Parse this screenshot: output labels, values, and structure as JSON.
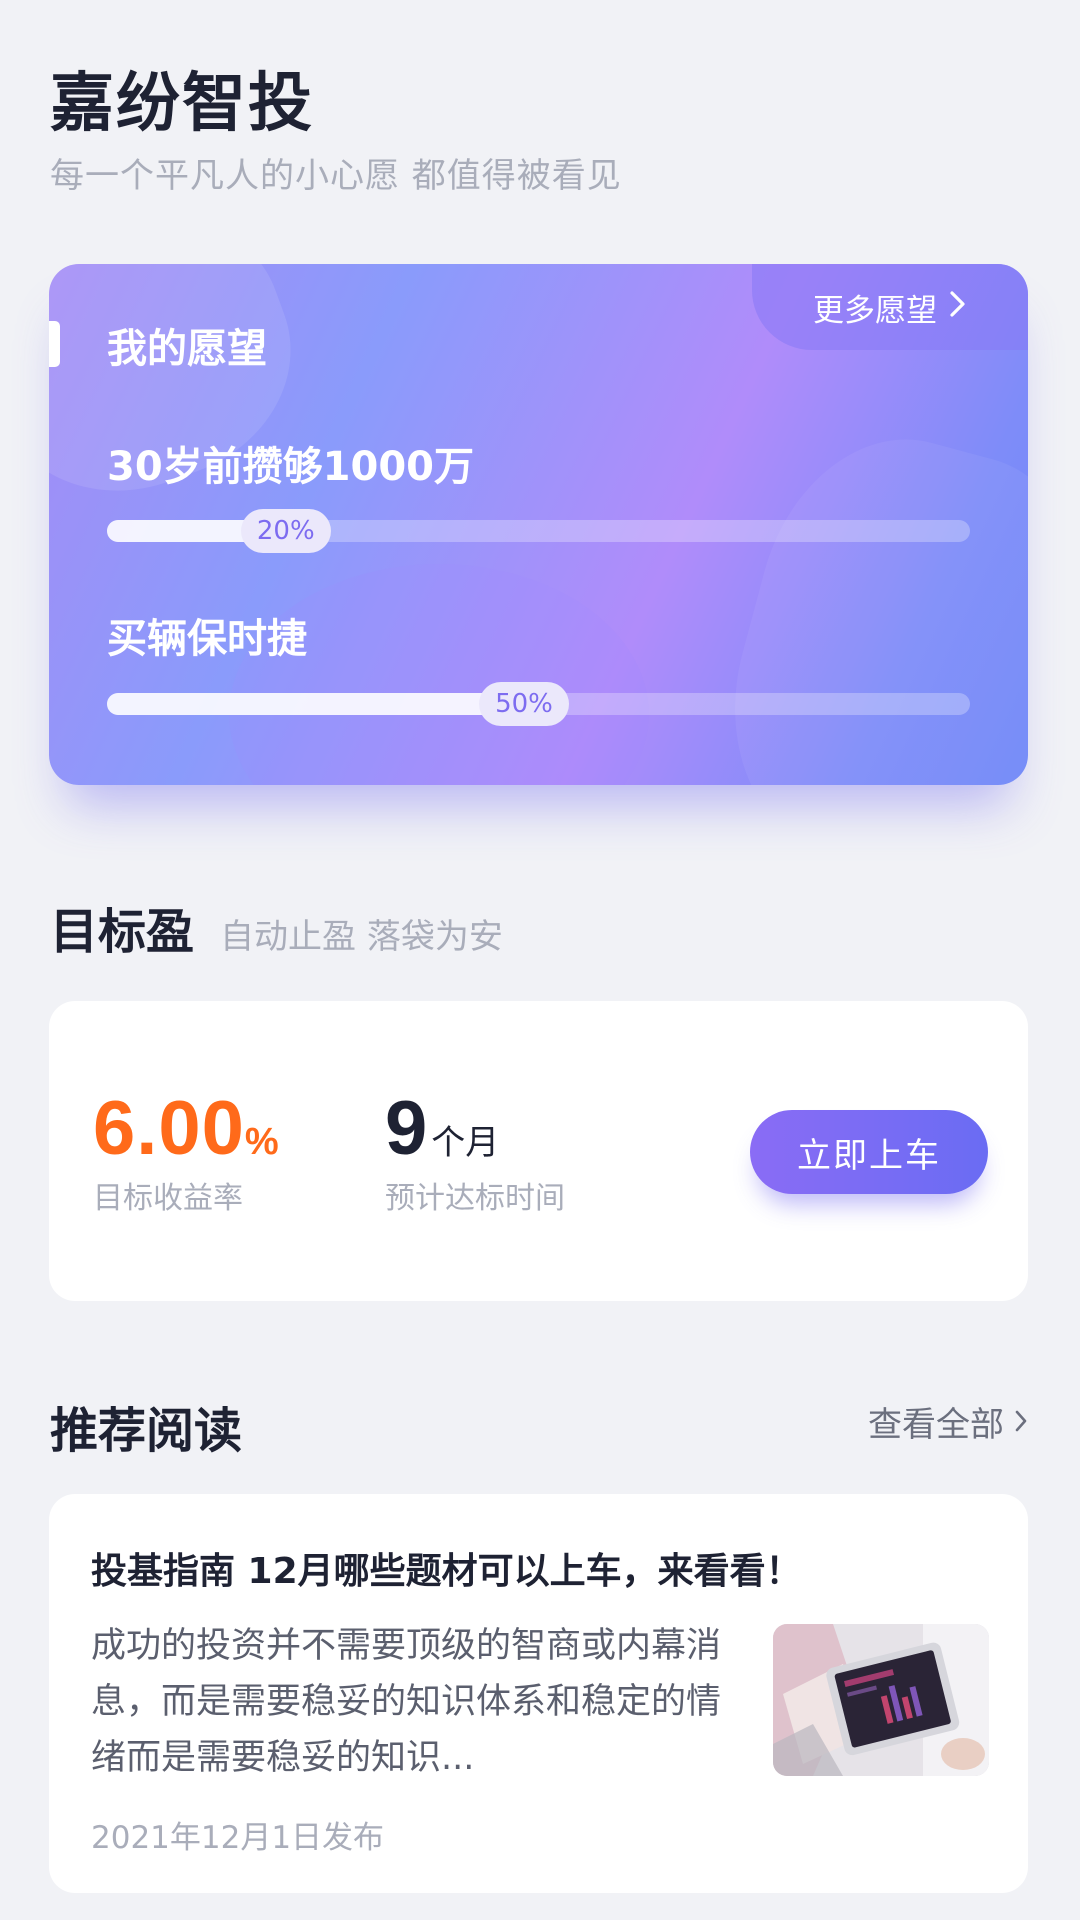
{
  "header": {
    "title": "嘉纷智投",
    "slogan": "每一个平凡人的小心愿 都值得被看见"
  },
  "wish_card": {
    "title": "我的愿望",
    "more_label": "更多愿望",
    "goals": [
      {
        "label": "30岁前攒够1000万",
        "progress_text": "20%",
        "progress": 0.2
      },
      {
        "label": "买辆保时捷",
        "progress_text": "50%",
        "progress": 0.5
      }
    ]
  },
  "target_section": {
    "title": "目标盈",
    "subtitle": "自动止盈 落袋为安",
    "rate_value": "6.00",
    "rate_unit": "%",
    "rate_label": "目标收益率",
    "months_value": "9",
    "months_unit": "个月",
    "months_label": "预计达标时间",
    "cta_label": "立即上车"
  },
  "reading_section": {
    "title": "推荐阅读",
    "view_all_label": "查看全部",
    "article": {
      "title": "投基指南 12月哪些题材可以上车，来看看！",
      "excerpt": "成功的投资并不需要顶级的智商或内幕消息，而是需要稳妥的知识体系和稳定的情绪而是需要稳妥的知识...",
      "date": "2021年12月1日发布"
    }
  },
  "icons": {
    "more_chevron": "chevron-right-icon",
    "view_all_chevron": "chevron-right-icon",
    "thumbnail": "tablet-reading-image"
  },
  "colors": {
    "accent_orange": "#ff6a1a",
    "accent_purple": "#7d6cf0",
    "background": "#f1f2f6"
  }
}
